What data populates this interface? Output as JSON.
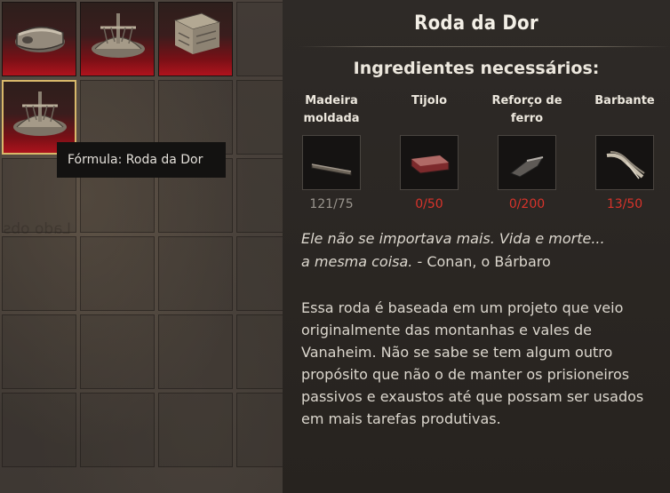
{
  "tooltip": {
    "text": "Fórmula: Roda da Dor"
  },
  "background_text": "Lado obs",
  "recipes": [
    {
      "icon": "wheel-cart-icon"
    },
    {
      "icon": "wheel-of-pain-icon"
    },
    {
      "icon": "stand-structure-icon"
    },
    {
      "icon": "wheel-of-pain-icon",
      "selected": true
    }
  ],
  "details": {
    "title": "Roda da Dor",
    "ingredients_heading": "Ingredientes necessários:",
    "ingredients": [
      {
        "name": "Madeira moldada",
        "count": "121/75",
        "status": "ok",
        "icon": "shaped-wood-icon"
      },
      {
        "name": "Tijolo",
        "count": "0/50",
        "status": "missing",
        "icon": "brick-icon"
      },
      {
        "name": "Reforço de ferro",
        "count": "0/200",
        "status": "missing",
        "icon": "iron-reinforcement-icon"
      },
      {
        "name": "Barbante",
        "count": "13/50",
        "status": "missing",
        "icon": "twine-icon"
      }
    ],
    "quote": {
      "line1": "Ele não se importava mais. Vida e morte...",
      "line2": "a mesma coisa.",
      "author": " - Conan, o Bárbaro"
    },
    "description": "Essa roda é baseada em um projeto que veio originalmente das montanhas e vales de Vanaheim. Não se sabe se tem algum outro propósito que não o de manter os prisioneiros passivos e exaustos até que possam ser usados em mais tarefas produtivas."
  },
  "colors": {
    "count_ok": "#9a958e",
    "count_missing": "#d8332b",
    "slot_red": "#b0131d",
    "selected_outline": "#d8b86a"
  }
}
